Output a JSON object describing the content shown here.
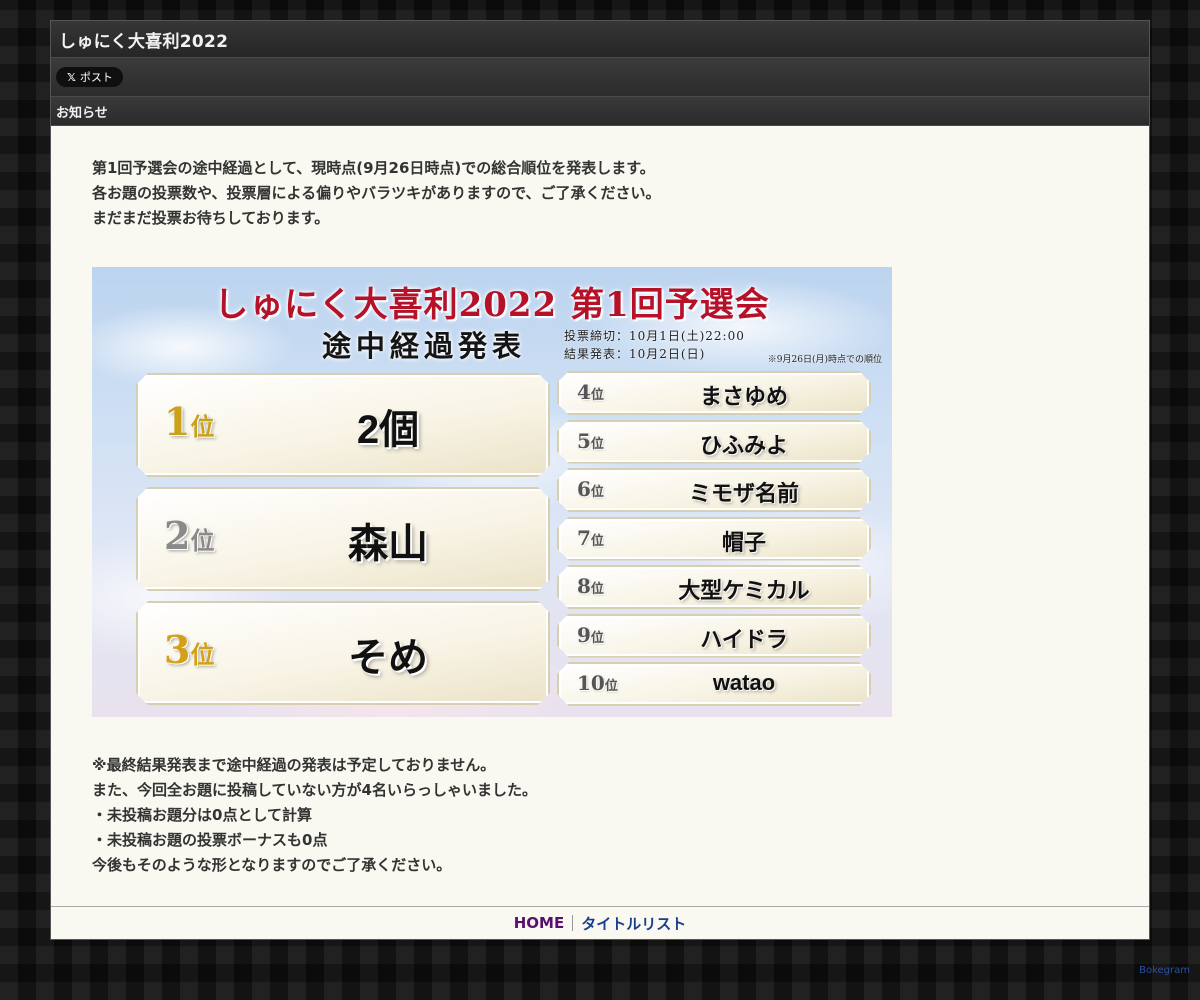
{
  "header": {
    "site_title": "しゅにく大喜利2022"
  },
  "share": {
    "post_icon": "x-logo-icon",
    "post_label": "ポスト"
  },
  "section": {
    "title": "お知らせ"
  },
  "intro": {
    "lines": [
      "第1回予選会の途中経過として、現時点(9月26日時点)での総合順位を発表します。",
      "各お題の投票数や、投票層による偏りやバラツキがありますので、ご了承ください。",
      "まだまだ投票お待ちしております。"
    ]
  },
  "banner": {
    "title": "しゅにく大喜利2022 第1回予選会",
    "subtitle": "途中経過発表",
    "deadline": "投票締切：10月1日(土)22:00",
    "announce": "結果発表：10月2日(日)",
    "note": "※9月26日(月)時点での順位",
    "rank_suffix": "位",
    "rank_colors": {
      "1": "#c9a21a",
      "2": "#8a8a8a",
      "3": "#d4a017",
      "other": "#555555"
    },
    "rankings": [
      {
        "rank": "1",
        "name": "2個"
      },
      {
        "rank": "2",
        "name": "森山"
      },
      {
        "rank": "3",
        "name": "そめ"
      },
      {
        "rank": "4",
        "name": "まさゆめ"
      },
      {
        "rank": "5",
        "name": "ひふみよ"
      },
      {
        "rank": "6",
        "name": "ミモザ名前"
      },
      {
        "rank": "7",
        "name": "帽子"
      },
      {
        "rank": "8",
        "name": "大型ケミカル"
      },
      {
        "rank": "9",
        "name": "ハイドラ"
      },
      {
        "rank": "10",
        "name": "watao"
      }
    ]
  },
  "notes": {
    "lines": [
      "※最終結果発表まで途中経過の発表は予定しておりません。",
      "また、今回全お題に投稿していない方が4名いらっしゃいました。",
      "・未投稿お題分は0点として計算",
      "・未投稿お題の投票ボーナスも0点",
      "今後もそのような形となりますのでご了承ください。"
    ]
  },
  "footer": {
    "home_label": "HOME",
    "home_color": "#5a0f6e",
    "title_list_label": "タイトルリスト",
    "title_list_color": "#1a3f8f"
  },
  "credit": {
    "label": "Bokegram"
  }
}
